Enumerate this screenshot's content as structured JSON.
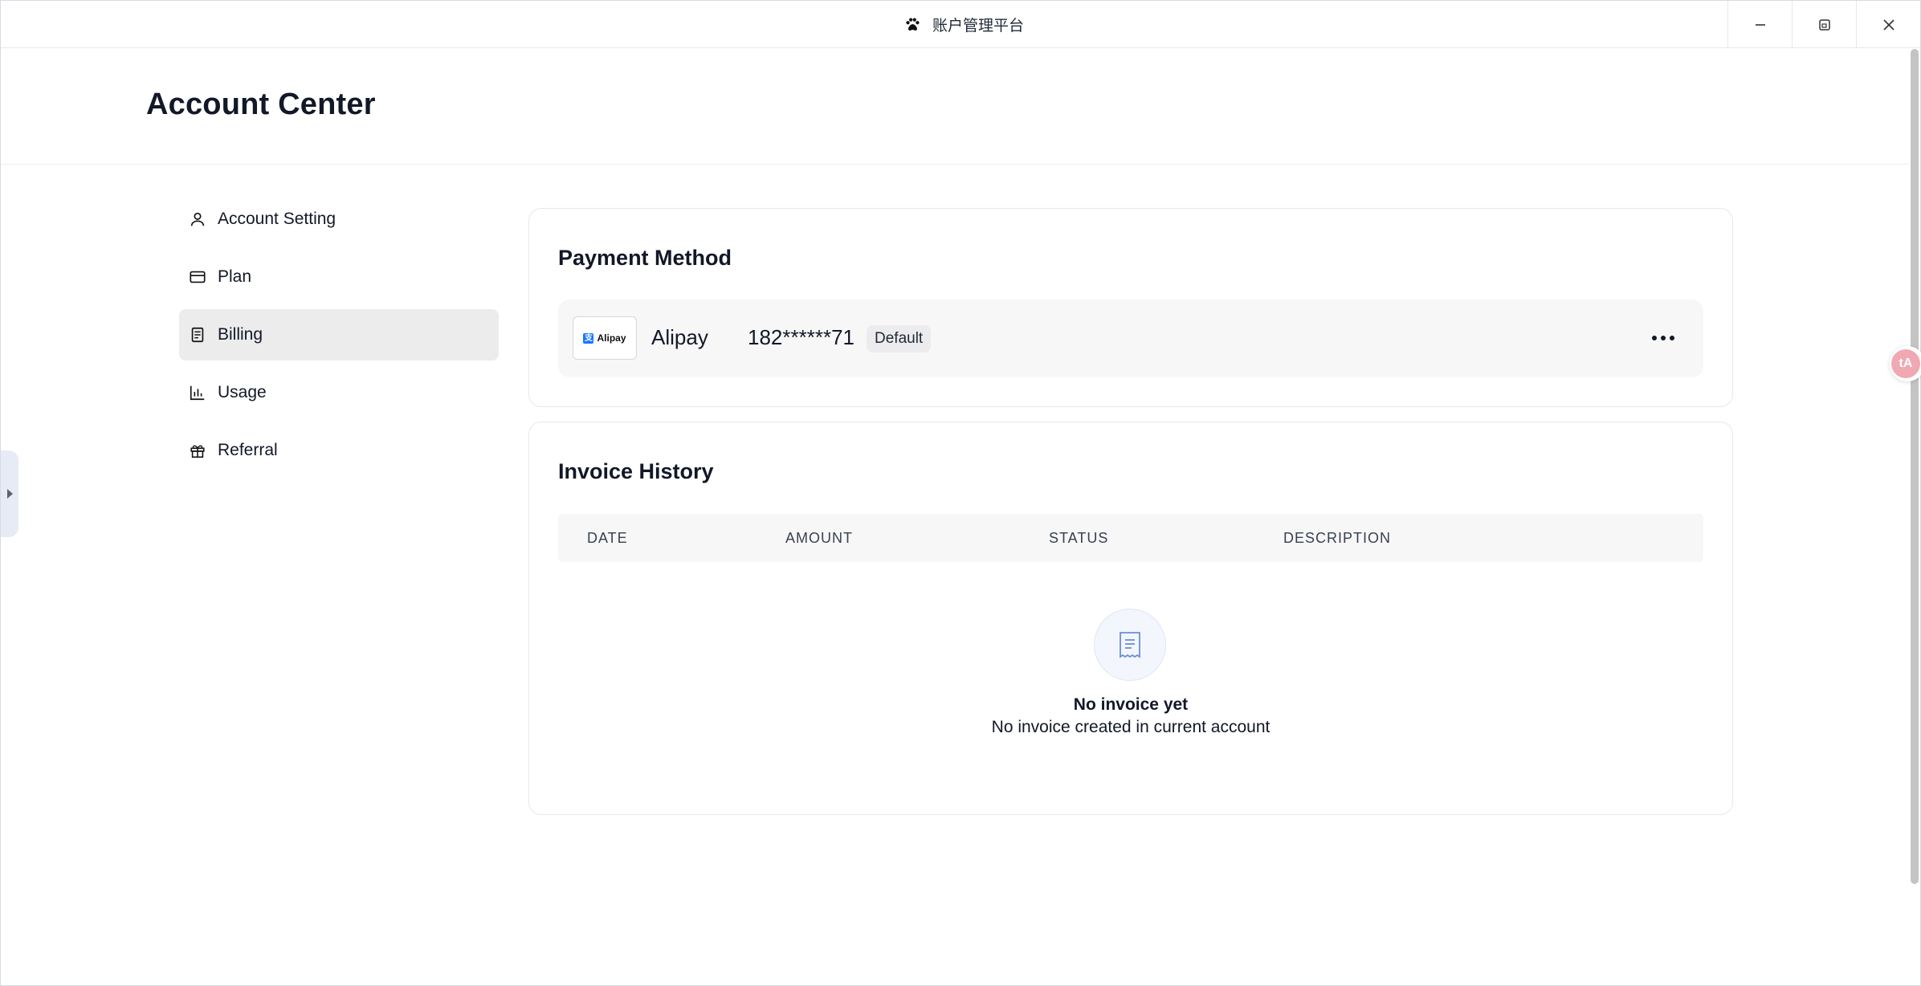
{
  "window": {
    "title": "账户管理平台",
    "controls": [
      "minimize-icon",
      "restore-icon",
      "close-icon"
    ]
  },
  "page": {
    "title": "Account Center"
  },
  "sidebar": {
    "items": [
      {
        "label": "Account Setting",
        "icon": "user-icon",
        "active": false
      },
      {
        "label": "Plan",
        "icon": "credit-card-icon",
        "active": false
      },
      {
        "label": "Billing",
        "icon": "receipt-icon",
        "active": true
      },
      {
        "label": "Usage",
        "icon": "bar-chart-icon",
        "active": false
      },
      {
        "label": "Referral",
        "icon": "gift-icon",
        "active": false
      }
    ]
  },
  "payment": {
    "title": "Payment Method",
    "method": {
      "logo_text": "Alipay",
      "name": "Alipay",
      "number": "182******71",
      "badge": "Default"
    }
  },
  "invoices": {
    "title": "Invoice History",
    "columns": [
      "DATE",
      "AMOUNT",
      "STATUS",
      "DESCRIPTION"
    ],
    "rows": [],
    "empty_title": "No invoice yet",
    "empty_subtitle": "No invoice created in current account"
  },
  "floating": {
    "translate_label": "tA"
  },
  "colors": {
    "accent": "#1677ff",
    "active_nav_bg": "#ececec",
    "card_border": "#e6e8ec"
  }
}
